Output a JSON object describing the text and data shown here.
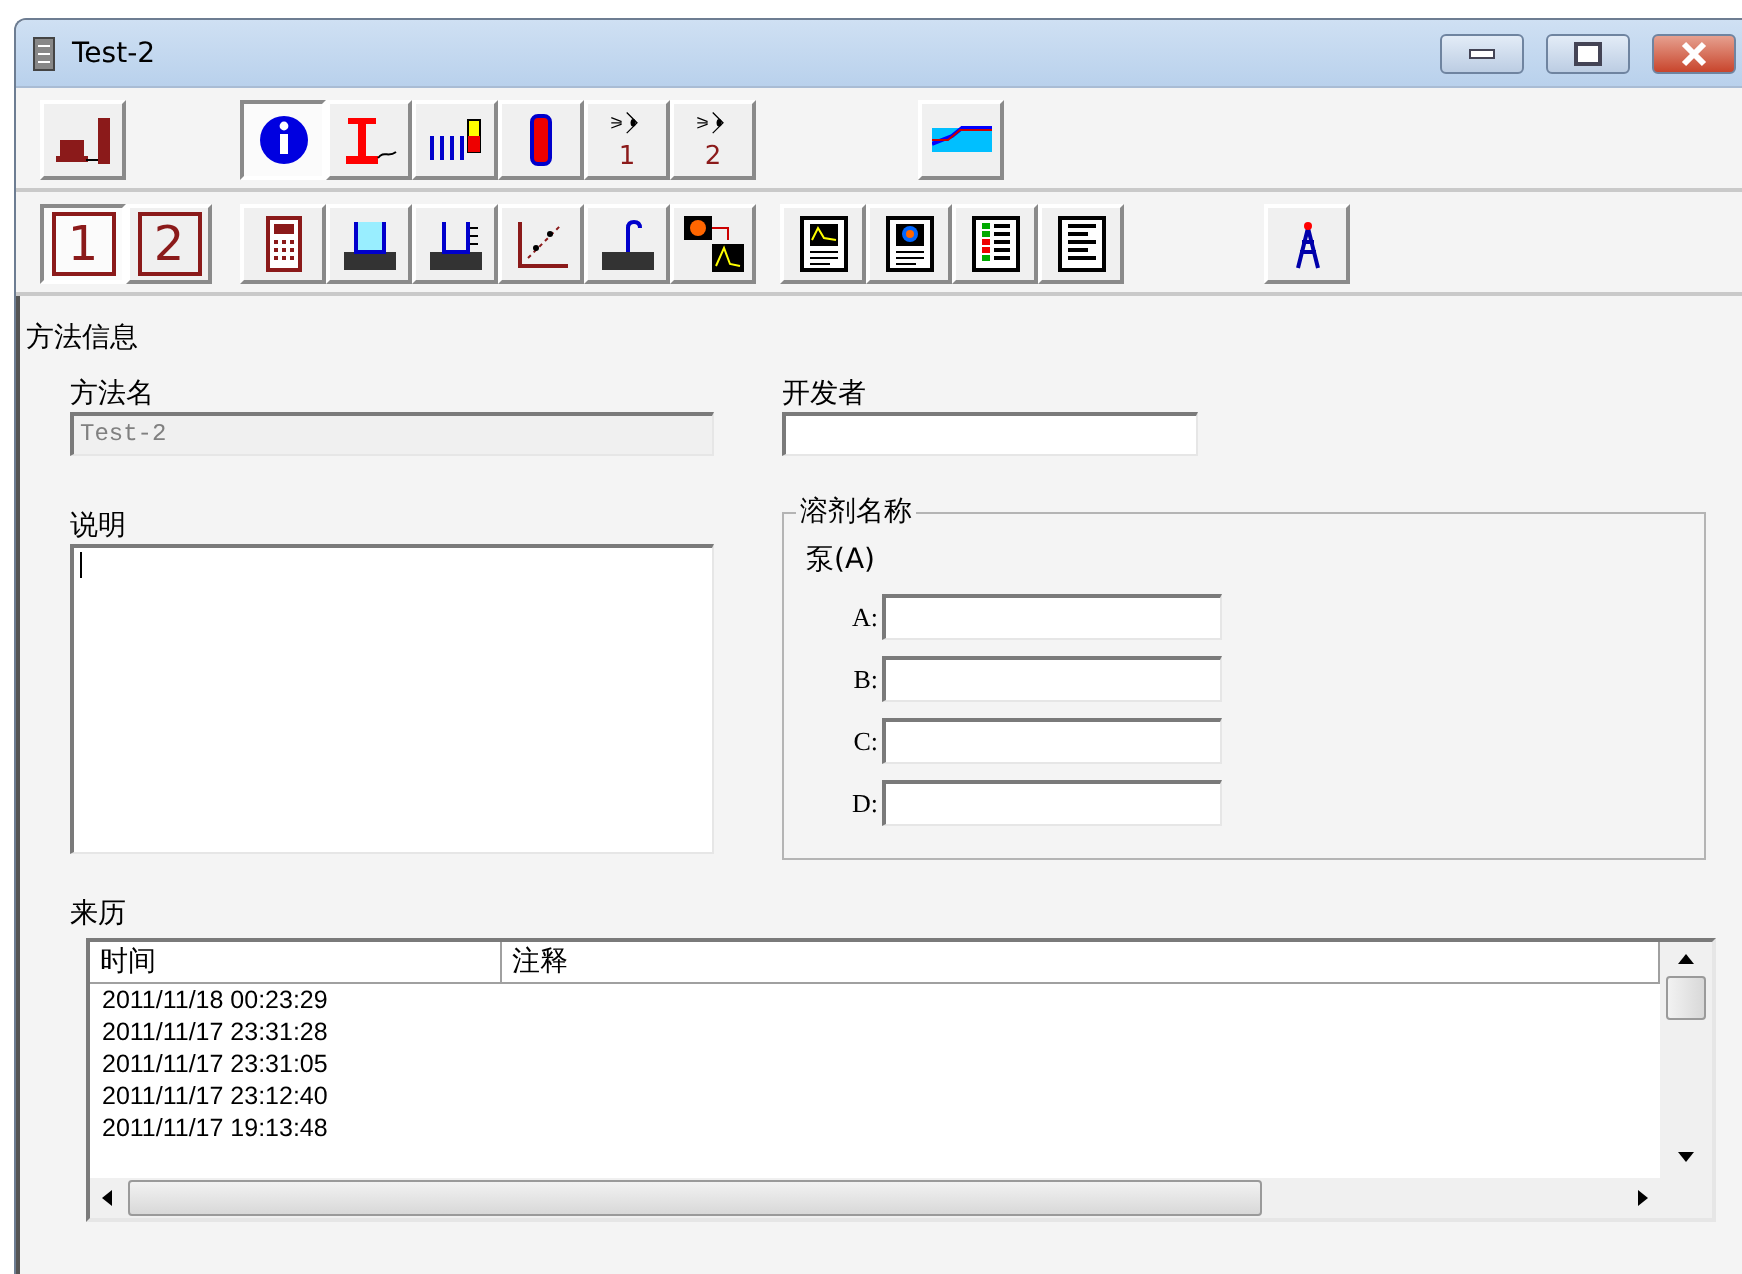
{
  "window": {
    "title": "Test-2"
  },
  "toolbar_1": {
    "groups": [
      [
        {
          "pressed": false
        }
      ],
      [
        {
          "pressed": true
        },
        {
          "pressed": false
        },
        {
          "pressed": false
        },
        {
          "pressed": false
        },
        {
          "pressed": false,
          "number": "1"
        },
        {
          "pressed": false,
          "number": "2"
        }
      ],
      [
        {
          "pressed": false
        }
      ]
    ]
  },
  "toolbar_2": {
    "groups": [
      [
        {
          "pressed": true,
          "label": "1"
        },
        {
          "pressed": false,
          "label": "2"
        }
      ],
      [
        {
          "pressed": false
        },
        {
          "pressed": false
        },
        {
          "pressed": false
        },
        {
          "pressed": false
        },
        {
          "pressed": false
        },
        {
          "pressed": false
        }
      ],
      [
        {
          "pressed": false
        },
        {
          "pressed": false
        },
        {
          "pressed": false
        },
        {
          "pressed": false
        }
      ],
      [
        {
          "pressed": false
        }
      ]
    ]
  },
  "section_title": "方法信息",
  "method_name": {
    "label": "方法名",
    "value": "Test-2",
    "disabled": true
  },
  "developer": {
    "label": "开发者"
  },
  "description": {
    "label": "说明"
  },
  "solvents": {
    "title": "溶剂名称",
    "pump": "泵(A)",
    "rows": [
      {
        "label": "A:"
      },
      {
        "label": "B:"
      },
      {
        "label": "C:"
      },
      {
        "label": "D:"
      }
    ]
  },
  "history": {
    "label": "来历",
    "columns": [
      "时间",
      "注释"
    ],
    "rows": [
      {
        "time": "2011/11/18 00:23:29"
      },
      {
        "time": "2011/11/17 23:31:28"
      },
      {
        "time": "2011/11/17 23:31:05"
      },
      {
        "time": "2011/11/17 23:12:40"
      },
      {
        "time": "2011/11/17 19:13:48"
      }
    ]
  }
}
